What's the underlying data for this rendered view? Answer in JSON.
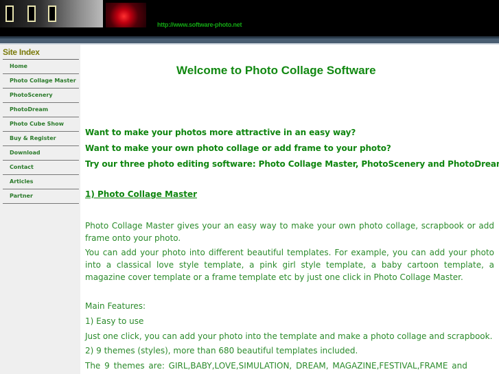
{
  "header": {
    "url": "http://www.software-photo.net"
  },
  "sidebar": {
    "title": "Site Index",
    "items": [
      {
        "label": "Home"
      },
      {
        "label": "Photo Collage Master"
      },
      {
        "label": "PhotoScenery"
      },
      {
        "label": "PhotoDream"
      },
      {
        "label": "Photo Cube Show"
      },
      {
        "label": "Buy & Register"
      },
      {
        "label": "Download"
      },
      {
        "label": "Contact"
      },
      {
        "label": "Articles"
      },
      {
        "label": "Partner"
      }
    ]
  },
  "main": {
    "welcome": "Welcome to Photo Collage Software",
    "intro": [
      "Want to make your photos more attractive in an easy way?",
      "Want to make your own photo collage or add frame to your photo?",
      "Try our three photo editing software: Photo Collage Master, PhotoScenery and PhotoDream !"
    ],
    "section_title": "1) Photo Collage Master",
    "para1": "Photo Collage Master gives your an easy way to make your own photo collage, scrapbook or add frame onto your photo.",
    "para2": "You can add your photo into different beautiful templates. For example, you can add your photo into a classical love style template, a pink girl style template, a baby cartoon template,  a magazine cover template  or a frame template etc by just one click in Photo Collage Master.",
    "features_heading": "Main Features:",
    "feature1": "1) Easy to use",
    "feature1_desc": "Just one click, you can add your photo into the template and make a photo collage and scrapbook.",
    "feature2": "2) 9 themes (styles), more than 680 beautiful templates included.",
    "feature2_desc": "The  9  themes  are: GIRL,BABY,LOVE,SIMULATION,  DREAM,  MAGAZINE,FESTIVAL,FRAME  and"
  },
  "colors": {
    "header_bg": "#000000",
    "link_green": "#14a814",
    "text_green": "#2a8a2a",
    "sidebar_bg": "#efefef",
    "sidebar_title": "#7a7a0a"
  }
}
